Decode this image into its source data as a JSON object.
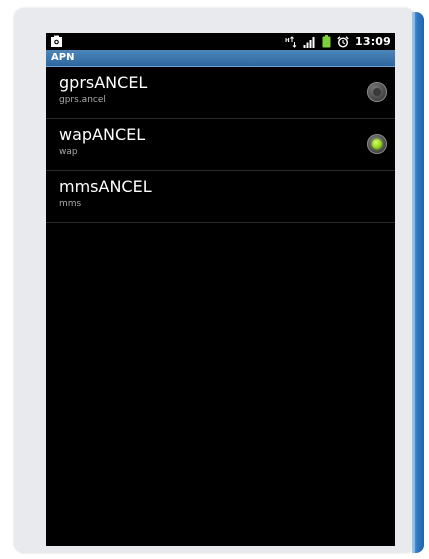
{
  "status_bar": {
    "time": "13:09",
    "icons": [
      "screenshot-app-icon",
      "data-transfer-icon",
      "signal-icon",
      "battery-icon",
      "alarm-icon"
    ]
  },
  "title_bar": {
    "title": "APN"
  },
  "apn_list": [
    {
      "name": "gprsANCEL",
      "apn": "gprs.ancel",
      "selected": false
    },
    {
      "name": "wapANCEL",
      "apn": "wap",
      "selected": true
    },
    {
      "name": "mmsANCEL",
      "apn": "mms"
    }
  ],
  "colors": {
    "title_bar": "#2e67a0",
    "selected_radio": "#8fd21b",
    "frame_accent": "#2e78c3",
    "screen_background": "#000000"
  }
}
